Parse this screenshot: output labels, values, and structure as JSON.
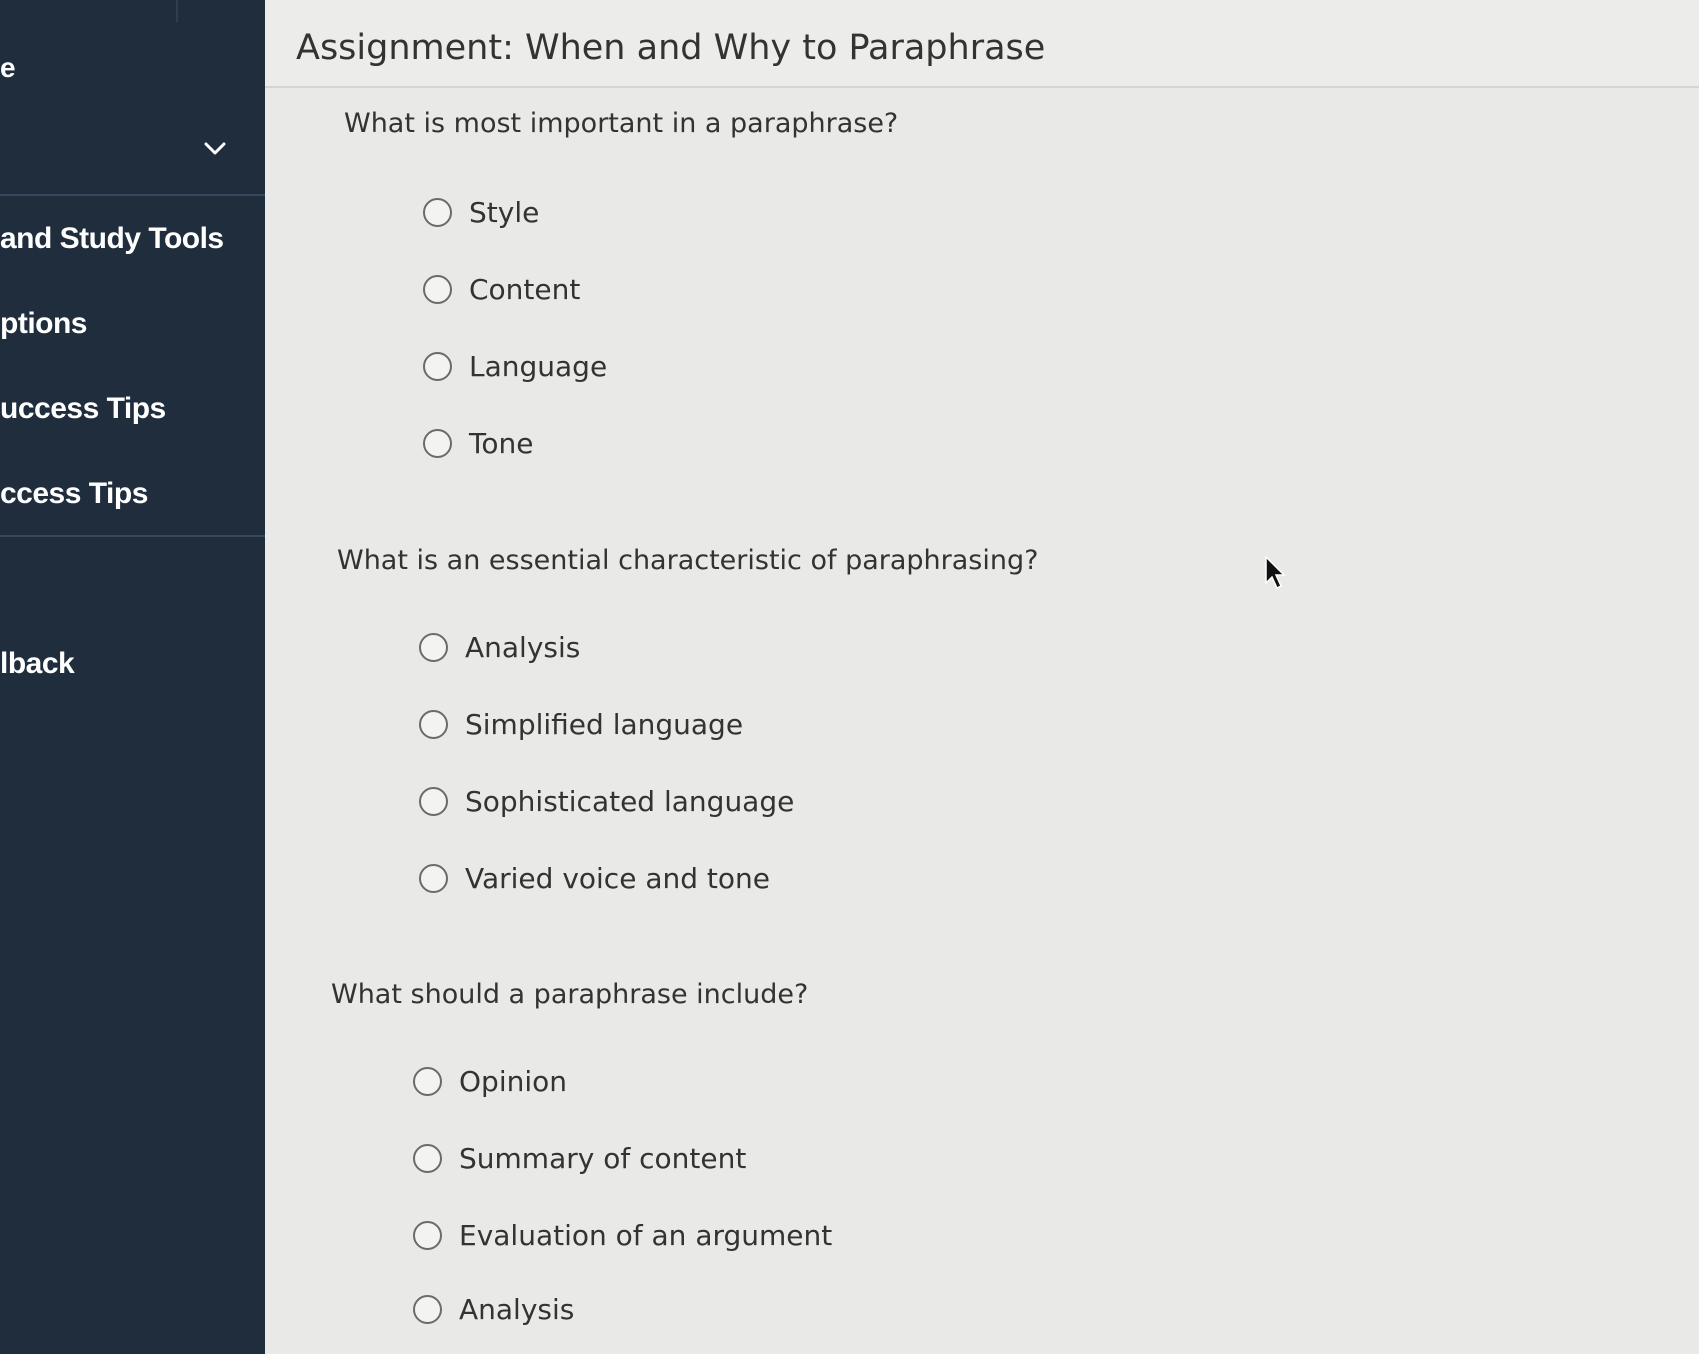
{
  "sidebar": {
    "header": "e",
    "items": [
      {
        "label": "and Study Tools"
      },
      {
        "label": "ptions"
      },
      {
        "label": "uccess Tips"
      },
      {
        "label": "ccess Tips"
      },
      {
        "label": "lback"
      }
    ],
    "chevron_icon": "chevron-down-icon"
  },
  "assignment": {
    "title": "Assignment: When and Why to Paraphrase"
  },
  "questions": [
    {
      "prompt": "What is most important in a paraphrase?",
      "options": [
        "Style",
        "Content",
        "Language",
        "Tone"
      ]
    },
    {
      "prompt": "What is an essential characteristic of paraphrasing?",
      "options": [
        "Analysis",
        "Simplified language",
        "Sophisticated language",
        "Varied voice and tone"
      ]
    },
    {
      "prompt": "What should a paraphrase include?",
      "options": [
        "Opinion",
        "Summary of content",
        "Evaluation of an argument",
        "Analysis"
      ]
    }
  ],
  "colors": {
    "sidebar_bg": "#1f2d3d",
    "page_bg": "#e9e9e7",
    "text": "#333333"
  }
}
